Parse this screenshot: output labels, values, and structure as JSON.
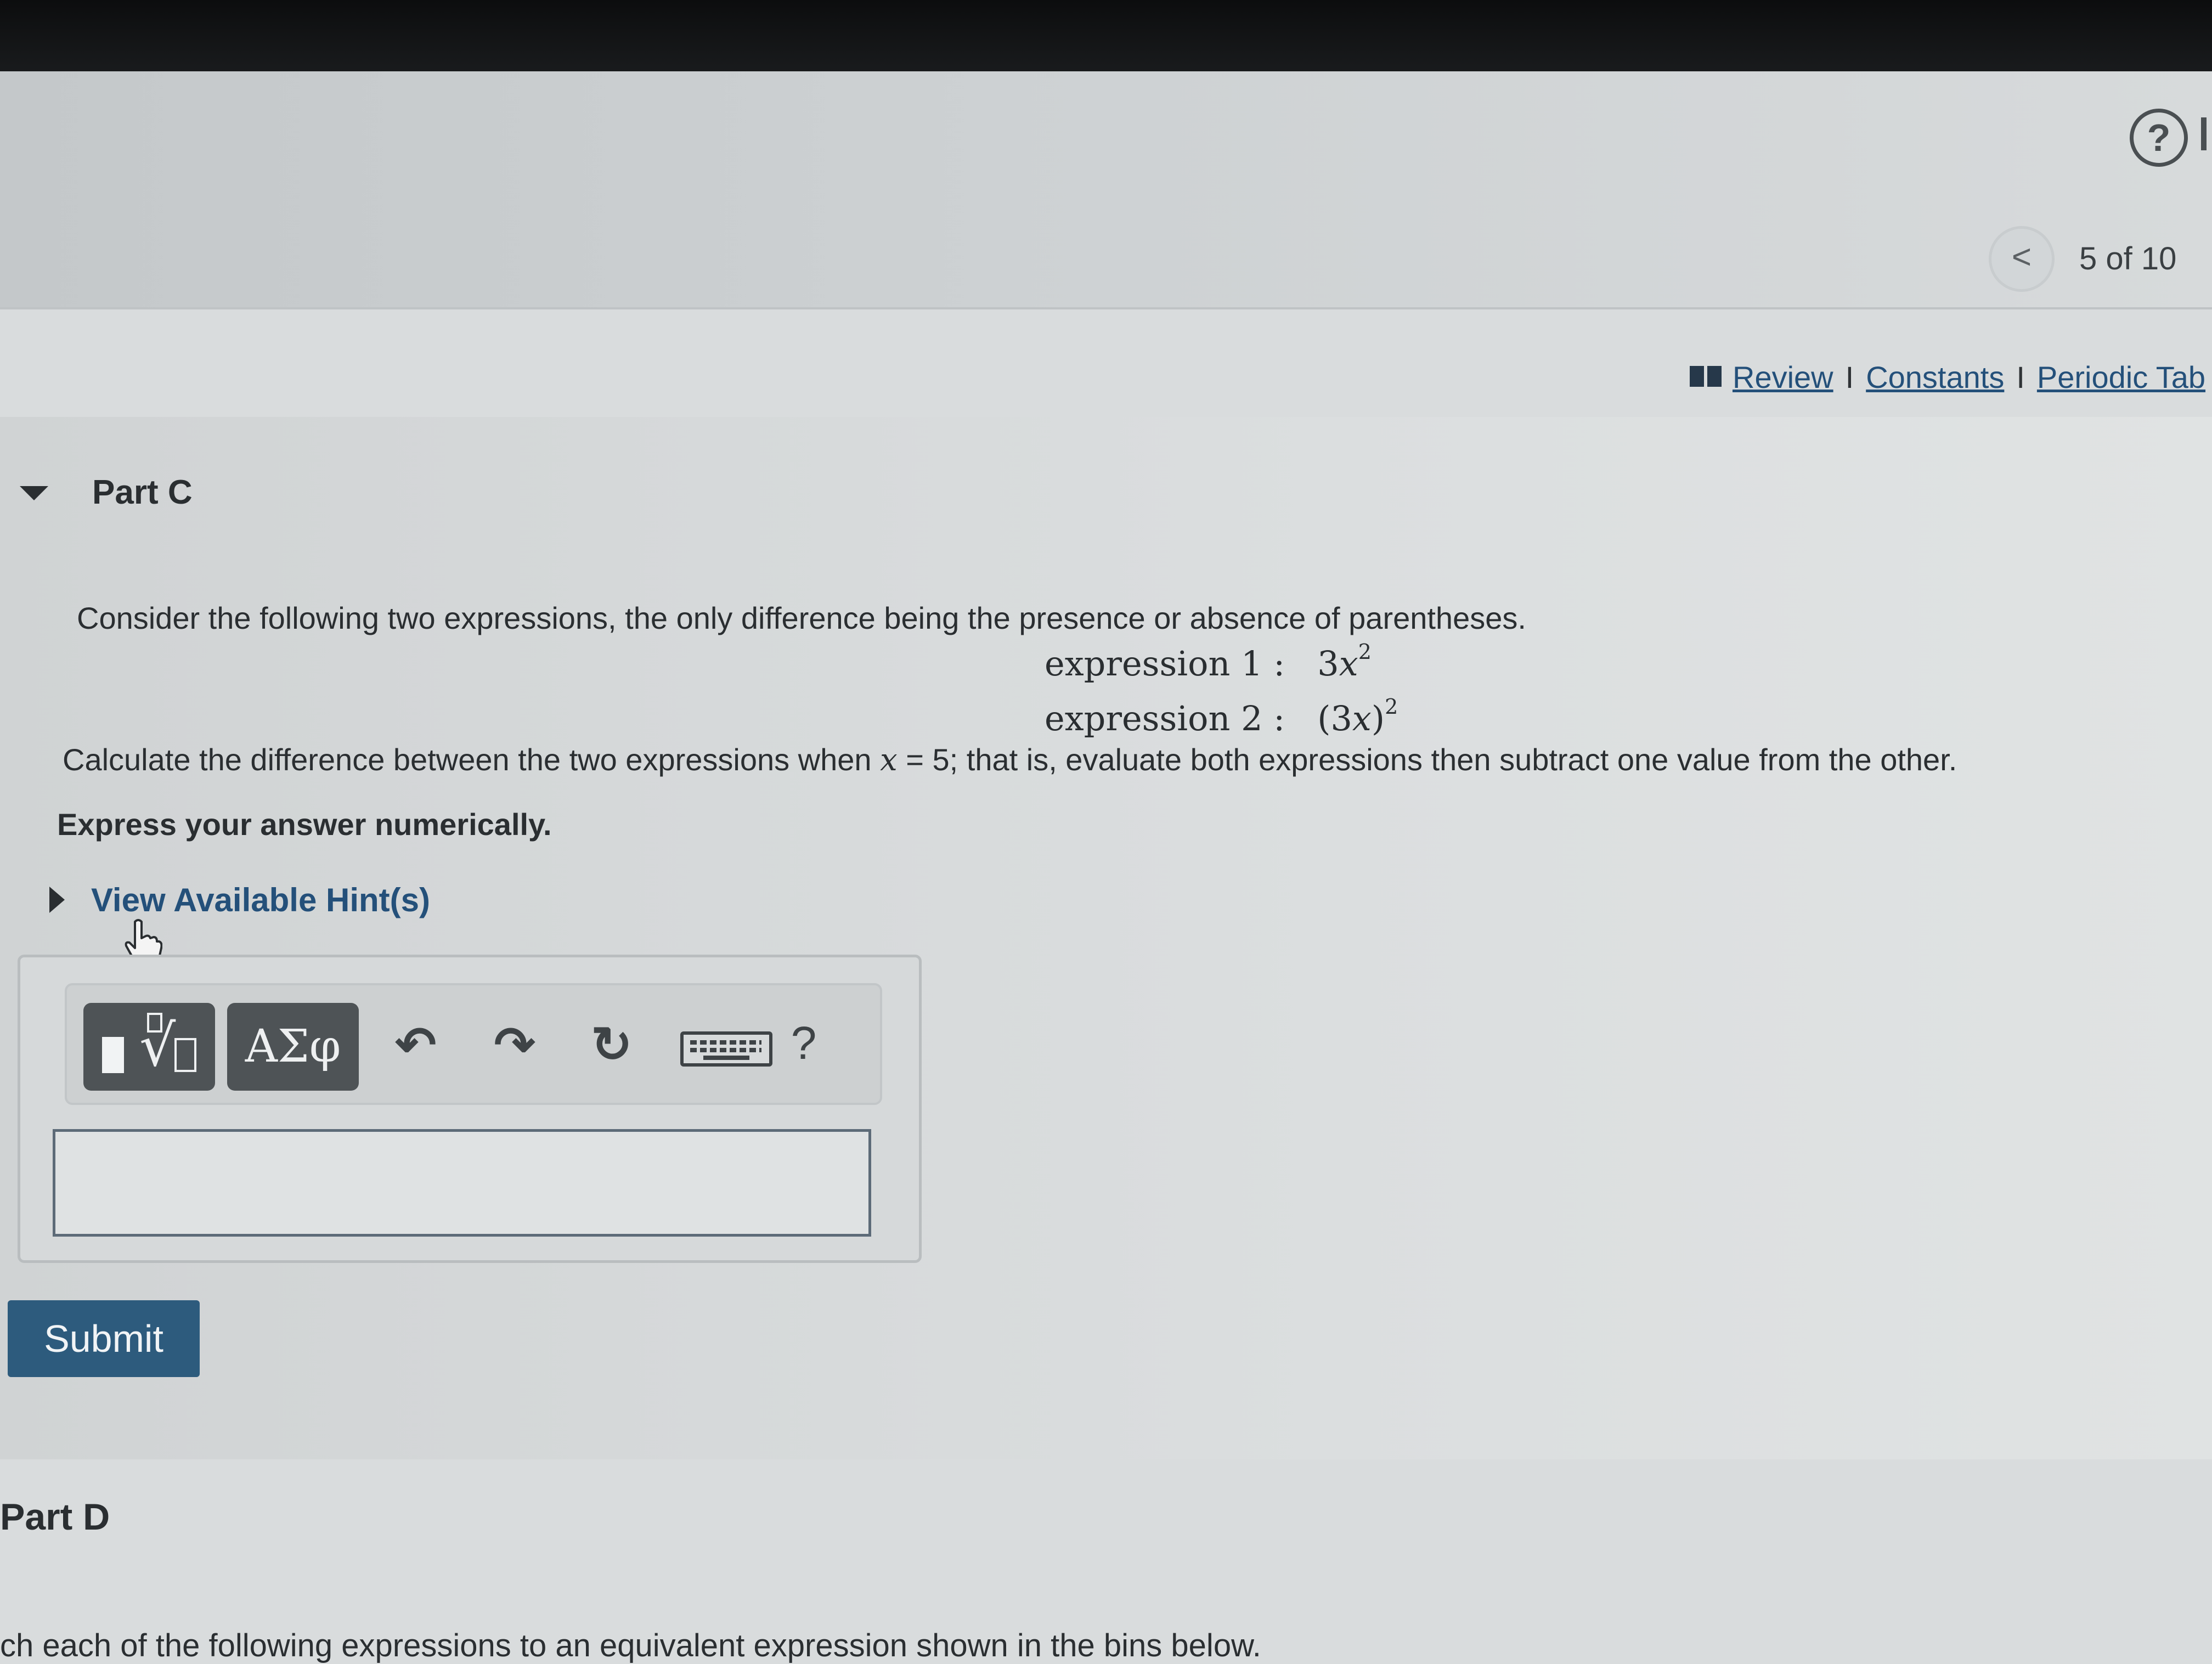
{
  "header": {
    "pager_text": "5 of 10",
    "help_glyph": "?",
    "prev_glyph": "<",
    "links": [
      {
        "label": "Review"
      },
      {
        "label": "Constants"
      },
      {
        "label": "Periodic Tab"
      }
    ],
    "link_separator": "I"
  },
  "part_c": {
    "title": "Part C",
    "intro": "Consider the following two expressions, the only difference being the presence or absence of parentheses.",
    "expression1": {
      "label": "expression 1 :",
      "coefficient": "3",
      "variable": "x",
      "exponent": "2"
    },
    "expression2": {
      "label": "expression 2 :",
      "open": "(3",
      "variable": "x",
      "close": ")",
      "exponent": "2"
    },
    "instruction": {
      "before": "Calculate the difference between the two expressions when ",
      "variable": "x",
      "after": " = 5; that is, evaluate both expressions then subtract one value from the other."
    },
    "express": "Express your answer numerically.",
    "hint_link": "View Available Hint(s)",
    "toolbar": {
      "templates_sqrt": "√",
      "greek": "ΑΣφ",
      "undo": "↶",
      "redo": "↷",
      "reset": "↻",
      "help": "?"
    },
    "answer_value": "",
    "submit_label": "Submit"
  },
  "part_d": {
    "title": "Part D",
    "intro_fragment": "ch each of the following expressions to an equivalent expression shown in the bins below."
  }
}
